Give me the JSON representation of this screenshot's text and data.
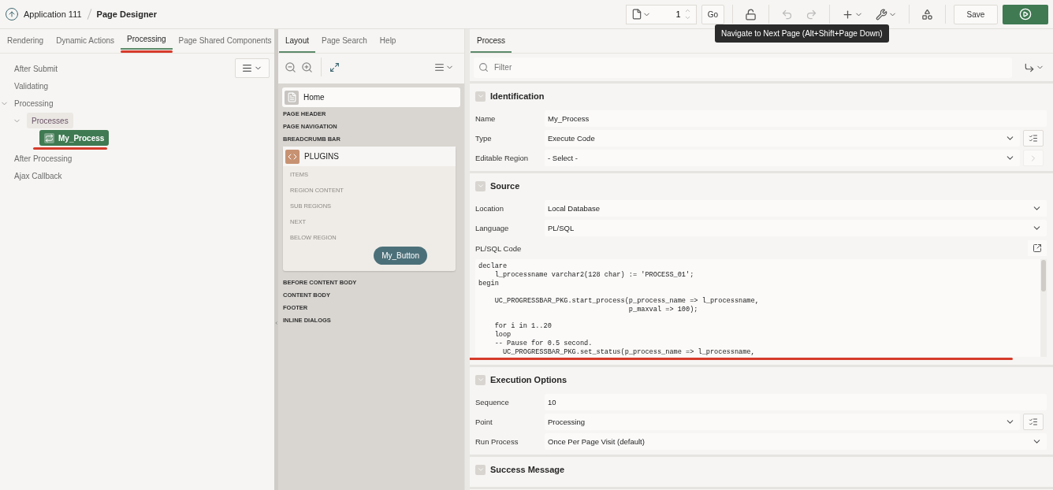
{
  "header": {
    "breadcrumb": [
      {
        "label": "Application 111"
      },
      {
        "label": "Page Designer"
      }
    ],
    "page_number": "1",
    "go_label": "Go",
    "save_label": "Save"
  },
  "tooltip": "Navigate to Next Page (Alt+Shift+Page Down)",
  "left": {
    "tabs": [
      {
        "label": "Rendering",
        "selected": false
      },
      {
        "label": "Dynamic Actions",
        "selected": false
      },
      {
        "label": "Processing",
        "selected": true,
        "underlined": true
      },
      {
        "label": "Page Shared Components",
        "selected": false
      }
    ],
    "tree": [
      {
        "label": "After Submit",
        "kind": "point",
        "selected": false
      },
      {
        "label": "Validating",
        "kind": "point",
        "selected": false
      },
      {
        "label": "Processing",
        "kind": "point",
        "selected": false,
        "expanded": true,
        "children": [
          {
            "label": "Processes",
            "kind": "group",
            "selected": false,
            "expanded": true,
            "children": [
              {
                "label": "My_Process",
                "kind": "process",
                "selected": true,
                "underlined": true
              }
            ]
          }
        ]
      },
      {
        "label": "After Processing",
        "kind": "point",
        "selected": false
      },
      {
        "label": "Ajax Callback",
        "kind": "point",
        "selected": false
      }
    ]
  },
  "middle": {
    "tabs": [
      {
        "label": "Layout",
        "selected": true
      },
      {
        "label": "Page Search",
        "selected": false
      },
      {
        "label": "Help",
        "selected": false
      }
    ],
    "page": "Home",
    "positions_top": [
      "PAGE HEADER",
      "PAGE NAVIGATION",
      "BREADCRUMB BAR"
    ],
    "region": {
      "title": "PLUGINS",
      "slots": [
        "ITEMS",
        "REGION CONTENT",
        "SUB REGIONS",
        "NEXT",
        "BELOW REGION"
      ],
      "button": "My_Button"
    },
    "positions_bottom": [
      "BEFORE CONTENT BODY",
      "CONTENT BODY",
      "FOOTER",
      "INLINE DIALOGS"
    ]
  },
  "right": {
    "tabs": [
      {
        "label": "Process",
        "selected": true
      }
    ],
    "filter_placeholder": "Filter",
    "sections": [
      {
        "title": "Identification",
        "fields": [
          {
            "label": "Name",
            "kind": "text",
            "value": "My_Process"
          },
          {
            "label": "Type",
            "kind": "select",
            "value": "Execute Code",
            "list_button": true
          },
          {
            "label": "Editable Region",
            "kind": "select",
            "value": "- Select -",
            "next_button": true
          }
        ]
      },
      {
        "title": "Source",
        "fields": [
          {
            "label": "Location",
            "kind": "select",
            "value": "Local Database"
          },
          {
            "label": "Language",
            "kind": "select",
            "value": "PL/SQL"
          },
          {
            "label": "PL/SQL Code",
            "kind": "code",
            "underlined": true,
            "code": "declare\n    l_processname varchar2(128 char) := 'PROCESS_01';\nbegin\n\n    UC_PROGRESSBAR_PKG.start_process(p_process_name => l_processname,\n                                     p_maxval => 100);\n\n    for i in 1..20\n    loop\n    -- Pause for 0.5 second.\n      UC_PROGRESSBAR_PKG.set_status(p_process_name => l_processname,"
          }
        ]
      },
      {
        "title": "Execution Options",
        "fields": [
          {
            "label": "Sequence",
            "kind": "text",
            "value": "10"
          },
          {
            "label": "Point",
            "kind": "select",
            "value": "Processing",
            "list_button": true
          },
          {
            "label": "Run Process",
            "kind": "select",
            "value": "Once Per Page Visit (default)"
          }
        ]
      },
      {
        "title": "Success Message"
      }
    ]
  }
}
